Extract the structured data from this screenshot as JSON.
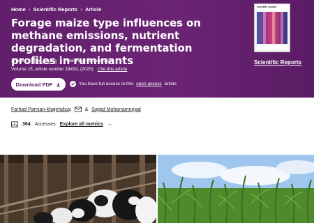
{
  "breadcrumb": {
    "home": "Home",
    "section": "Scientific Reports",
    "current": "Article",
    "separator": "›"
  },
  "article": {
    "title": "Forage maize type influences on methane emissions, nutrient degradation, and fermentation profiles in ruminants",
    "type": "Article",
    "access": "Open access",
    "published": "Published: 03 June 2025",
    "volume": "Volume 15, article number 19433, (2025)",
    "cite": "Cite this article"
  },
  "actions": {
    "download_label": "Download PDF",
    "access_note_prefix": "You have full access to this",
    "access_note_link": "open access",
    "access_note_suffix": "article"
  },
  "journal": {
    "name": "Scientific Reports",
    "cover_label": "scientific reports"
  },
  "authors": {
    "first": "Farhad Parnian-khajehdizaj",
    "joiner": "&",
    "second": "Sajjad Moharramnejad"
  },
  "metrics": {
    "accesses_count": "364",
    "accesses_label": "Accesses",
    "explore_link": "Explore all metrics",
    "arrow": "→"
  },
  "colors": {
    "banner": "#611f6b",
    "text_dark": "#222222"
  }
}
